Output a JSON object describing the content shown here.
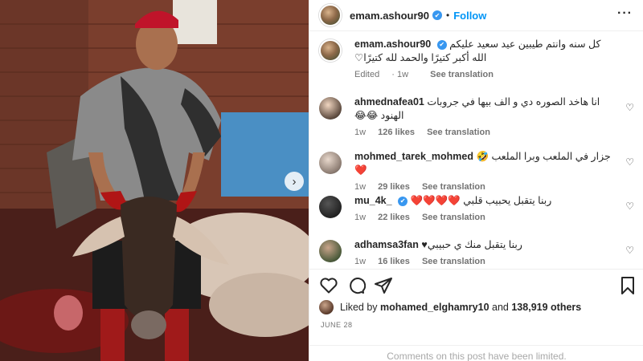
{
  "post": {
    "username": "emam.ashour90",
    "dot": "•",
    "follow_label": "Follow",
    "more_icon": "more-horizontal-icon",
    "accent": "#0095f6",
    "verified_color": "#3897f0"
  },
  "caption": {
    "username": "emam.ashour90",
    "text": "كل سنه وانتم طيبين عيد سعيد عليكم الله أكبر كتيرًا والحمد لله كتيرًا♡",
    "edited": "Edited",
    "age": "1w",
    "see_translation": "See translation"
  },
  "comments": [
    {
      "username": "ahmednafea01",
      "text": "انا هاخد الصوره دي و الف بيها في جروبات الهنود 😂😂",
      "age": "1w",
      "likes": "126 likes",
      "see_translation": "See translation"
    },
    {
      "username": "mohmed_tarek_mohmed",
      "text": "جزار في الملعب وبرا الملعب 🤣 ❤️",
      "age": "1w",
      "likes": "29 likes",
      "see_translation": "See translation"
    },
    {
      "username": "mu_4k_",
      "text": "ربنا يتقبل يحبيب قلبي ❤️❤️❤️❤️",
      "age": "1w",
      "likes": "22 likes",
      "see_translation": "See translation",
      "verified": true
    },
    {
      "username": "adhamsa3fan",
      "text": "ربنا يتقبل منك ي حبيبي♥",
      "age": "1w",
      "likes": "16 likes",
      "see_translation": "See translation"
    }
  ],
  "actions": {
    "icons": [
      "heart-icon",
      "comment-icon",
      "share-icon",
      "bookmark-icon"
    ]
  },
  "likes_summary": {
    "prefix": "Liked by",
    "user": "mohamed_elghamry10",
    "middle": "and",
    "count": "138,919 others"
  },
  "date": "JUNE 28",
  "comments_limited": "Comments on this post have been limited."
}
